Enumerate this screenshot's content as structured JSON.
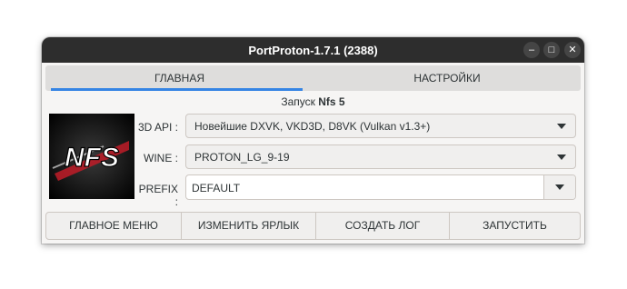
{
  "window": {
    "title": "PortProton-1.7.1 (2388)",
    "controls": {
      "minimize": "–",
      "maximize": "□",
      "close": "✕"
    }
  },
  "tabs": [
    {
      "label": "ГЛАВНАЯ",
      "active": true
    },
    {
      "label": "НАСТРОЙКИ",
      "active": false
    }
  ],
  "launch": {
    "prefix": "Запуск",
    "game": "Nfs 5"
  },
  "logo": {
    "text": "NFS"
  },
  "fields": {
    "api": {
      "label": "3D API :",
      "value": "Новейшие DXVK, VKD3D, D8VK (Vulkan v1.3+)"
    },
    "wine": {
      "label": "WINE :",
      "value": "PROTON_LG_9-19"
    },
    "prefix": {
      "label": "PREFIX :",
      "value": "DEFAULT"
    }
  },
  "actions": [
    "ГЛАВНОЕ МЕНЮ",
    "ИЗМЕНИТЬ ЯРЛЫК",
    "СОЗДАТЬ ЛОГ",
    "ЗАПУСТИТЬ"
  ],
  "colors": {
    "accent": "#3584e4",
    "titlebar": "#2d2d2d",
    "logo_text": "#ffffff",
    "logo_stripe": "#c01c28"
  }
}
